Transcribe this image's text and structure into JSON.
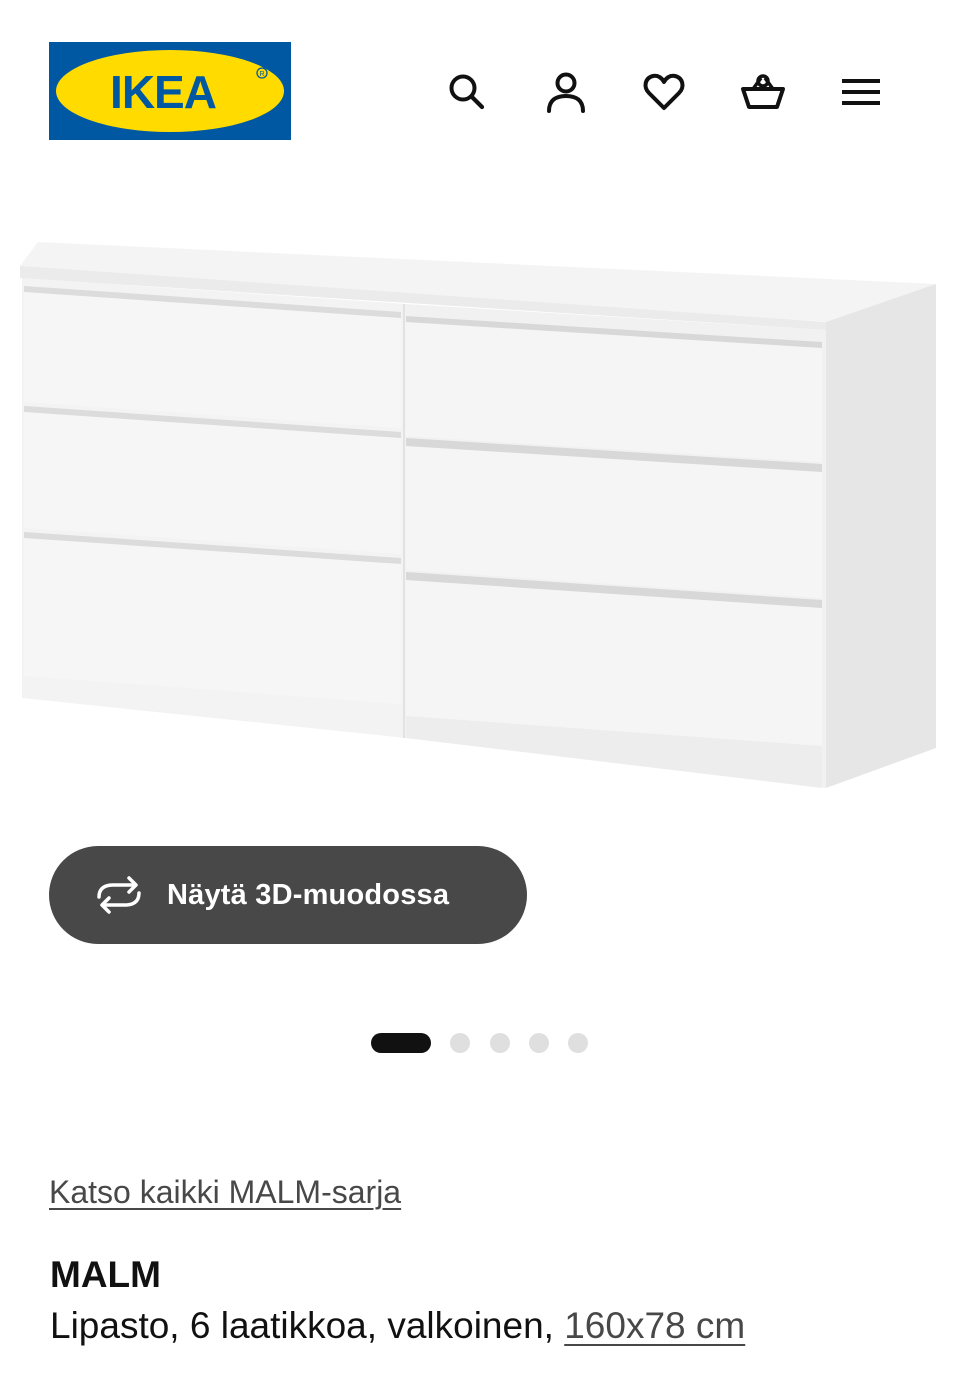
{
  "header": {
    "logo_text": "IKEA",
    "logo_colors": {
      "blue": "#0058a3",
      "yellow": "#ffdb00"
    },
    "icons": [
      "search-icon",
      "account-icon",
      "heart-icon",
      "basket-icon",
      "menu-icon"
    ]
  },
  "gallery": {
    "view_3d_label": "Näytä 3D-muodossa",
    "image_count": 5,
    "active_index": 0
  },
  "product": {
    "series_link": "Katso kaikki MALM-sarja",
    "name": "MALM",
    "description": "Lipasto, 6 laatikkoa, valkoinen,",
    "size": "160x78 cm"
  }
}
